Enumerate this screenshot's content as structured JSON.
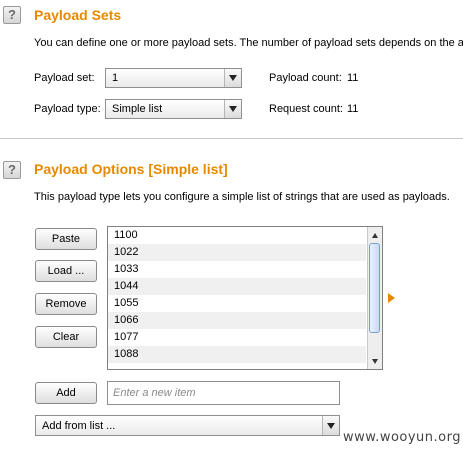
{
  "payload_sets": {
    "help": "?",
    "title": "Payload Sets",
    "description": "You can define one or more payload sets. The number of payload sets depends on the at",
    "set_label": "Payload set:",
    "set_value": "1",
    "type_label": "Payload type:",
    "type_value": "Simple list",
    "payload_count_label": "Payload count:",
    "payload_count_value": "11",
    "request_count_label": "Request count:",
    "request_count_value": "11"
  },
  "payload_options": {
    "help": "?",
    "title": "Payload Options [Simple list]",
    "description": "This payload type lets you configure a simple list of strings that are used as payloads.",
    "buttons": {
      "paste": "Paste",
      "load": "Load ...",
      "remove": "Remove",
      "clear": "Clear",
      "add": "Add"
    },
    "items": [
      "1100",
      "1022",
      "1033",
      "1044",
      "1055",
      "1066",
      "1077",
      "1088"
    ],
    "new_item_placeholder": "Enter a new item",
    "add_from_list": "Add from list ..."
  },
  "watermark": "www.wooyun.org",
  "colors": {
    "accent": "#e58a00"
  }
}
